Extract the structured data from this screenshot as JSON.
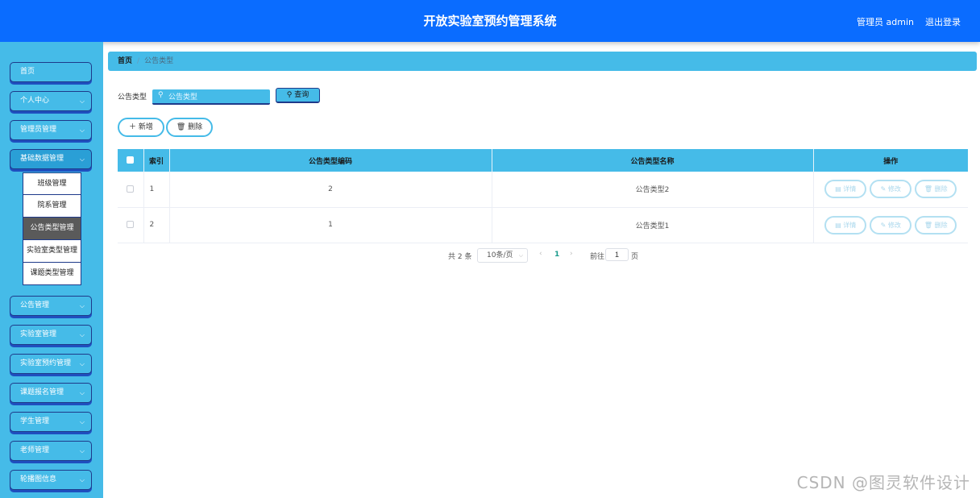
{
  "header": {
    "title": "开放实验室预约管理系统",
    "user": "管理员 admin",
    "logout": "退出登录"
  },
  "sidebar": {
    "items": [
      {
        "label": "首页"
      },
      {
        "label": "个人中心"
      },
      {
        "label": "管理员管理"
      },
      {
        "label": "基础数据管理"
      },
      {
        "label": "公告管理"
      },
      {
        "label": "实验室管理"
      },
      {
        "label": "实验室预约管理"
      },
      {
        "label": "课题报名管理"
      },
      {
        "label": "学生管理"
      },
      {
        "label": "老师管理"
      },
      {
        "label": "轮播图信息"
      }
    ],
    "submenu": [
      {
        "label": "班级管理"
      },
      {
        "label": "院系管理"
      },
      {
        "label": "公告类型管理"
      },
      {
        "label": "实验室类型管理"
      },
      {
        "label": "课题类型管理"
      }
    ]
  },
  "breadcrumb": {
    "home": "首页",
    "separator": "/",
    "current": "公告类型"
  },
  "search": {
    "label": "公告类型",
    "placeholder": "公告类型",
    "button": "查询"
  },
  "actions": {
    "add": "新增",
    "delete": "删除"
  },
  "table": {
    "headers": {
      "index": "索引",
      "code": "公告类型编码",
      "name": "公告类型名称",
      "ops": "操作"
    },
    "rows": [
      {
        "index": "1",
        "code": "2",
        "name": "公告类型2"
      },
      {
        "index": "2",
        "code": "1",
        "name": "公告类型1"
      }
    ],
    "ops": {
      "detail": "详情",
      "edit": "修改",
      "delete": "删除"
    }
  },
  "pager": {
    "total": "共 2 条",
    "page_size": "10条/页",
    "current": "1",
    "goto_label": "前往",
    "goto_value": "1",
    "page_suffix": "页"
  },
  "watermark": "CSDN @图灵软件设计",
  "colors": {
    "header": "#0a6cff",
    "accent": "#45bbe8",
    "border_dark": "#1e3a8a"
  }
}
